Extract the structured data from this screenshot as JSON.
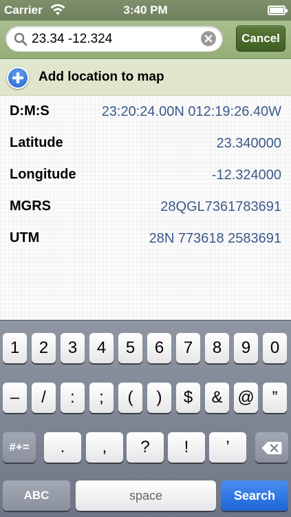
{
  "status_bar": {
    "carrier": "Carrier",
    "time": "3:40 PM"
  },
  "search": {
    "value": "23.34 -12.324",
    "cancel_label": "Cancel"
  },
  "add_location": {
    "label": "Add location to map"
  },
  "coordinates": [
    {
      "key": "D:M:S",
      "value": "23:20:24.00N 012:19:26.40W"
    },
    {
      "key": "Latitude",
      "value": "23.340000"
    },
    {
      "key": "Longitude",
      "value": "-12.324000"
    },
    {
      "key": "MGRS",
      "value": "28QGL7361783691"
    },
    {
      "key": "UTM",
      "value": "28N 773618 2583691"
    }
  ],
  "keyboard": {
    "row1": [
      "1",
      "2",
      "3",
      "4",
      "5",
      "6",
      "7",
      "8",
      "9",
      "0"
    ],
    "row2": [
      "–",
      "/",
      ":",
      ";",
      "(",
      ")",
      "$",
      "&",
      "@",
      "”"
    ],
    "row3": [
      "#+=",
      ".",
      ",",
      "?",
      "!",
      "’"
    ],
    "row4": {
      "abc": "ABC",
      "space": "space",
      "search": "Search"
    }
  },
  "colors": {
    "header_green": "#a9c08e",
    "cancel_green": "#4d6a2e",
    "value_blue": "#3b5a8a",
    "search_blue": "#1e66d8"
  }
}
